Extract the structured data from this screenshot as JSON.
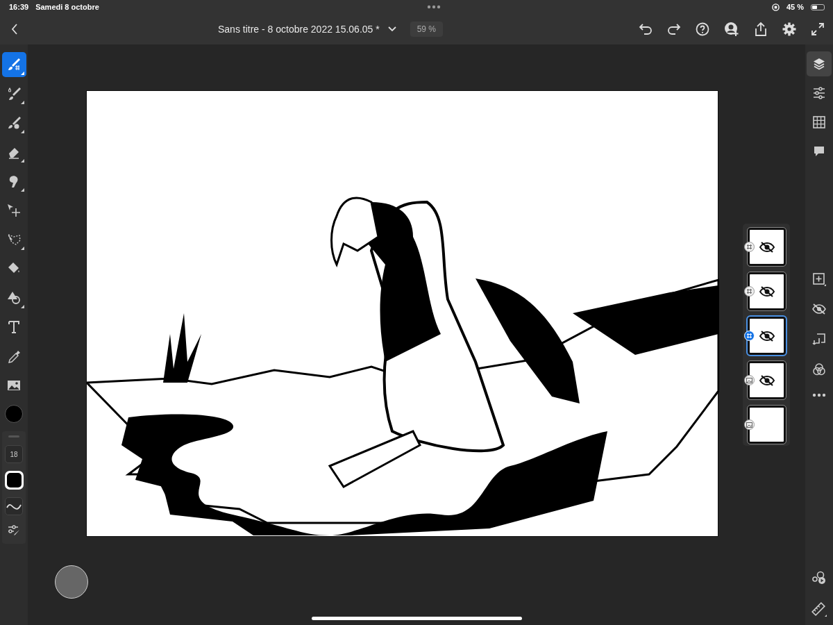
{
  "status_bar": {
    "time": "16:39",
    "date": "Samedi 8 octobre",
    "battery_text": "45 %"
  },
  "top_bar": {
    "title": "Sans titre - 8 octobre 2022 15.06.05 *",
    "zoom": "59 %"
  },
  "tools": [
    {
      "kind": "live-brush",
      "selected": true,
      "more": true
    },
    {
      "kind": "pixel-brush",
      "selected": false,
      "more": true
    },
    {
      "kind": "vector-brush",
      "selected": false,
      "more": true
    },
    {
      "kind": "eraser",
      "selected": false,
      "more": true
    },
    {
      "kind": "smudge",
      "selected": false,
      "more": true
    },
    {
      "kind": "move",
      "selected": false,
      "more": false
    },
    {
      "kind": "lasso",
      "selected": false,
      "more": true
    },
    {
      "kind": "fill",
      "selected": false,
      "more": false
    },
    {
      "kind": "shape",
      "selected": false,
      "more": true
    },
    {
      "kind": "text",
      "selected": false,
      "more": false
    },
    {
      "kind": "eyedropper",
      "selected": false,
      "more": false
    },
    {
      "kind": "image",
      "selected": false,
      "more": false
    }
  ],
  "brush": {
    "size": "18"
  },
  "side_panels": [
    {
      "kind": "layers",
      "selected": true
    },
    {
      "kind": "adjustments",
      "selected": false
    },
    {
      "kind": "grid",
      "selected": false
    },
    {
      "kind": "comments",
      "selected": false
    }
  ],
  "layers": [
    {
      "kind": "vector",
      "hidden": true,
      "selected": false
    },
    {
      "kind": "vector",
      "hidden": true,
      "selected": false
    },
    {
      "kind": "vector",
      "hidden": true,
      "selected": true
    },
    {
      "kind": "image",
      "hidden": true,
      "selected": false
    },
    {
      "kind": "image",
      "hidden": false,
      "selected": false
    }
  ]
}
